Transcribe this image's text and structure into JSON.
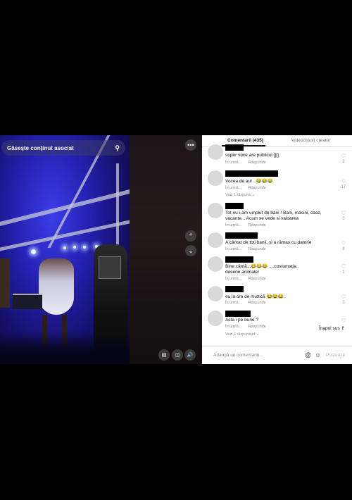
{
  "video": {
    "search_text": "Găsește conținut asociat",
    "icons": {
      "search": "search-icon",
      "more": "more-icon",
      "up": "chevron-up-icon",
      "down": "chevron-down-icon",
      "captions": "captions-icon",
      "pip": "picture-in-picture-icon",
      "volume": "volume-icon"
    }
  },
  "panel": {
    "tabs": [
      "Comentarii (435)",
      "Videoclipuri creator"
    ],
    "comments": [
      {
        "text": "super voce are publicul [][]",
        "meta_when": "În urmă...",
        "reply": "Răspunde",
        "likes": "2",
        "replies": ""
      },
      {
        "text": "Vocea de aur ..😂😂😂",
        "meta_when": "În urmă...",
        "reply": "Răspunde",
        "likes": "17",
        "replies": "Vezi 1 răspuns ⌄"
      },
      {
        "text": "Tot nu i-am umplut de bani ! Bani, masini, case,",
        "text2": "vacante... Acum se vede si valoarea",
        "meta_when": "În urmă...",
        "reply": "Răspunde",
        "likes": "0",
        "replies": ""
      },
      {
        "text": "A cântat de toți banii, și a rămas cu datorie",
        "meta_when": "În urmă...",
        "reply": "Răspunde",
        "likes": "8",
        "replies": ""
      },
      {
        "text": "Bine cântă...😂😂😂 ....costumația..",
        "text2": "desene animate!",
        "meta_when": "În urmă...",
        "reply": "Răspunde",
        "likes": "1",
        "replies": ""
      },
      {
        "text": "eu la ora de muzică 😂😂😂.",
        "meta_when": "În urmă...",
        "reply": "Răspunde",
        "likes": "0",
        "replies": ""
      },
      {
        "text": "Asta i pe bune ?",
        "meta_when": "În urmă...",
        "reply": "Răspunde",
        "likes": "",
        "replies": "Vezi 4 răspunsuri ⌄"
      }
    ],
    "back_to_top": "Înapoi sus ⇑",
    "add_comment": "Adaugă un comentariu...",
    "post": "Postează",
    "icons": {
      "like": "heart-icon",
      "mention": "at-icon",
      "emoji": "emoji-icon"
    }
  }
}
